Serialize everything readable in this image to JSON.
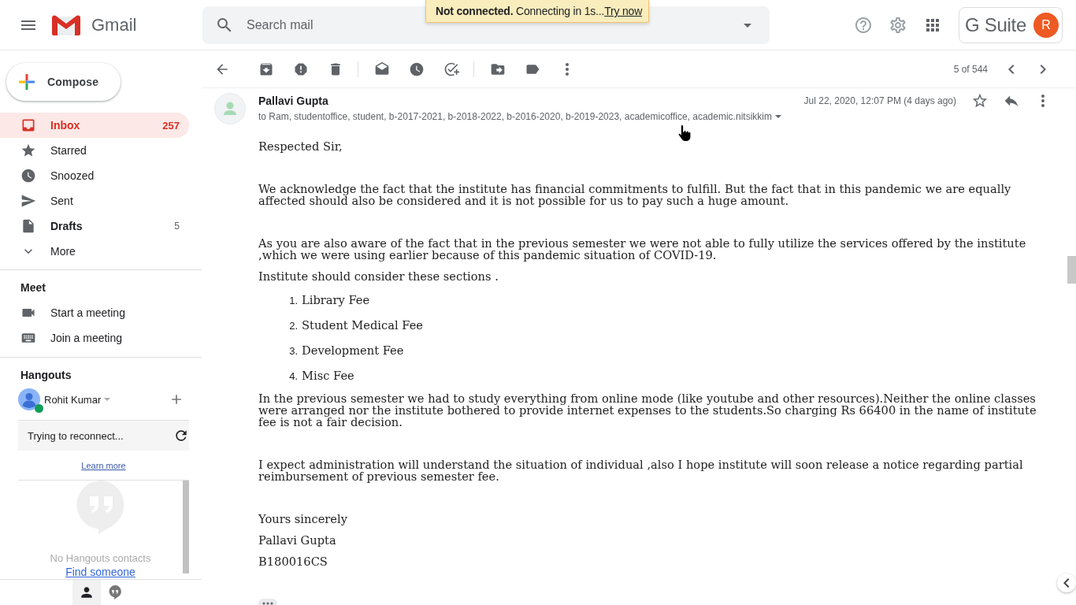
{
  "app": {
    "name": "Gmail"
  },
  "search": {
    "placeholder": "Search mail"
  },
  "toast": {
    "message": "**Not connected.** Connecting in 1s...",
    "action": "Try now"
  },
  "account": {
    "product": "G Suite",
    "initial": "R"
  },
  "compose": {
    "label": "Compose"
  },
  "nav": [
    {
      "kind": "inbox",
      "label": "Inbox",
      "count": "257",
      "selected": true,
      "unread": true
    },
    {
      "kind": "starred",
      "label": "Starred",
      "selected": false,
      "unread": false
    },
    {
      "kind": "snoozed",
      "label": "Snoozed",
      "selected": false,
      "unread": false
    },
    {
      "kind": "sent",
      "label": "Sent",
      "selected": false,
      "unread": false
    },
    {
      "kind": "drafts",
      "label": "Drafts",
      "count": "5",
      "selected": false,
      "unread": true
    },
    {
      "kind": "more",
      "label": "More",
      "selected": false,
      "unread": false
    }
  ],
  "meet": {
    "title": "Meet",
    "items": [
      {
        "kind": "video",
        "label": "Start a meeting"
      },
      {
        "kind": "keyboard",
        "label": "Join a meeting"
      }
    ]
  },
  "hangouts": {
    "title": "Hangouts",
    "user": {
      "name": "Rohit Kumar",
      "online": true
    },
    "status": "Trying to reconnect...",
    "learn_more": "Learn more",
    "empty_message": "No Hangouts contacts",
    "find_link": "Find someone",
    "tabs": [
      {
        "kind": "contacts",
        "selected": true
      },
      {
        "kind": "conversations",
        "selected": false
      }
    ]
  },
  "toolbar": {
    "position": "5 of 544"
  },
  "message": {
    "sender": "Pallavi Gupta",
    "recipients": "to Ram, studentoffice, student, b-2017-2021, b-2018-2022, b-2016-2020, b-2019-2023, academicoffice, academic.nitsikkim",
    "date": "Jul 22, 2020, 12:07 PM (4 days ago)",
    "starred": false,
    "body": [
      {
        "blocks": [
          {
            "kind": "paragraph",
            "text": "Respected Sir,"
          }
        ]
      },
      {
        "blocks": [
          {
            "kind": "paragraph",
            "text": "We acknowledge the fact that the institute has financial commitments to fulfill. But the fact that in this pandemic we are equally affected should also be considered and it is not possible for us to pay such a huge amount."
          }
        ]
      },
      {
        "blocks": [
          {
            "kind": "paragraph",
            "text": "As you are also aware of the fact that in the previous semester we were not able to fully utilize the services offered by the institute ,which we were using earlier because of this pandemic situation of COVID-19."
          },
          {
            "kind": "paragraph",
            "text": "Institute should consider these sections ."
          },
          {
            "kind": "list",
            "items": [
              {
                "marker": "1.",
                "text": "Library Fee"
              },
              {
                "marker": "2.",
                "text": "Student Medical Fee"
              },
              {
                "marker": "3.",
                "text": "Development Fee"
              },
              {
                "marker": "4.",
                "text": "Misc Fee"
              }
            ]
          },
          {
            "kind": "paragraph",
            "text": "In the previous semester we had to study everything from online mode (like youtube and other resources).Neither the online classes were arranged nor the institute bothered to provide internet expenses to the students.So charging Rs 66400 in the name of institute fee is not a fair decision."
          }
        ]
      },
      {
        "blocks": [
          {
            "kind": "paragraph",
            "text": "I expect administration will understand the situation of individual ,also I hope institute will soon release a notice regarding partial reimbursement of previous semester fee."
          }
        ]
      },
      {
        "blocks": [
          {
            "kind": "paragraph",
            "text": "Yours sincerely"
          },
          {
            "kind": "paragraph",
            "text": "Pallavi Gupta"
          },
          {
            "kind": "paragraph",
            "text": "B180016CS"
          }
        ]
      }
    ]
  }
}
